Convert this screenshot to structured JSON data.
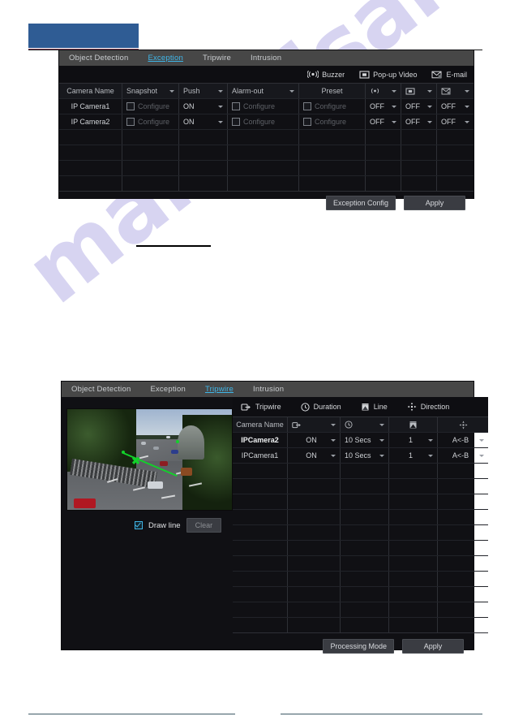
{
  "watermark": {
    "text": "manualsarchive.com"
  },
  "panel_exception": {
    "tabs": [
      {
        "label": "Object Detection",
        "active": false
      },
      {
        "label": "Exception",
        "active": true
      },
      {
        "label": "Tripwire",
        "active": false
      },
      {
        "label": "Intrusion",
        "active": false
      }
    ],
    "actions": [
      {
        "label": "Buzzer",
        "icon": "buzzer-icon"
      },
      {
        "label": "Pop-up Video",
        "icon": "popup-video-icon"
      },
      {
        "label": "E-mail",
        "icon": "email-icon"
      }
    ],
    "columns": [
      {
        "label": "Camera Name",
        "icon": null,
        "select": false
      },
      {
        "label": "Snapshot",
        "icon": null,
        "select": true
      },
      {
        "label": "Push",
        "icon": null,
        "select": true
      },
      {
        "label": "Alarm-out",
        "icon": null,
        "select": true
      },
      {
        "label": "Preset",
        "icon": null,
        "select": false
      },
      {
        "label": "",
        "icon": "buzzer-icon",
        "select": true
      },
      {
        "label": "",
        "icon": "popup-video-icon",
        "select": true
      },
      {
        "label": "",
        "icon": "email-icon",
        "select": true
      }
    ],
    "rows": [
      {
        "camera_name": "IP Camera1",
        "snapshot_checked": false,
        "snapshot_label": "Configure",
        "push": "ON",
        "alarm_out_checked": false,
        "alarm_out_label": "Configure",
        "preset_checked": false,
        "preset_label": "Configure",
        "buzzer": "OFF",
        "popup_video": "OFF",
        "email": "OFF"
      },
      {
        "camera_name": "IP Camera2",
        "snapshot_checked": false,
        "snapshot_label": "Configure",
        "push": "ON",
        "alarm_out_checked": false,
        "alarm_out_label": "Configure",
        "preset_checked": false,
        "preset_label": "Configure",
        "buzzer": "OFF",
        "popup_video": "OFF",
        "email": "OFF"
      }
    ],
    "empty_row_count": 4,
    "buttons": {
      "exception_config": "Exception Config",
      "apply": "Apply"
    }
  },
  "panel_tripwire": {
    "tabs": [
      {
        "label": "Object Detection",
        "active": false
      },
      {
        "label": "Exception",
        "active": false
      },
      {
        "label": "Tripwire",
        "active": true
      },
      {
        "label": "Intrusion",
        "active": false
      }
    ],
    "toolbar": [
      {
        "label": "Tripwire",
        "icon": "tripwire-icon"
      },
      {
        "label": "Duration",
        "icon": "clock-icon"
      },
      {
        "label": "Line",
        "icon": "line-icon"
      },
      {
        "label": "Direction",
        "icon": "direction-icon"
      }
    ],
    "preview": {
      "draw_line_label": "Draw line",
      "draw_line_checked": true,
      "clear_label": "Clear"
    },
    "columns": [
      {
        "label": "Camera Name",
        "icon": null,
        "select": false
      },
      {
        "label": "",
        "icon": "tripwire-icon",
        "select": true
      },
      {
        "label": "",
        "icon": "clock-icon",
        "select": true
      },
      {
        "label": "",
        "icon": "line-icon",
        "select": false
      },
      {
        "label": "",
        "icon": "direction-icon",
        "select": false
      }
    ],
    "rows": [
      {
        "camera_name": "IPCamera2",
        "tripwire": "ON",
        "duration": "10 Secs",
        "line": "1",
        "direction": "A<-B"
      },
      {
        "camera_name": "IPCamera1",
        "tripwire": "ON",
        "duration": "10 Secs",
        "line": "1",
        "direction": "A<-B"
      }
    ],
    "empty_row_count": 11,
    "buttons": {
      "processing_mode": "Processing Mode",
      "apply": "Apply"
    }
  },
  "colors": {
    "accent_blue": "#3fb6e8",
    "header_block": "#2f5c94",
    "panel_bg": "#101014",
    "tabbar_bg": "#474747",
    "tripline_green": "#12d12a"
  }
}
